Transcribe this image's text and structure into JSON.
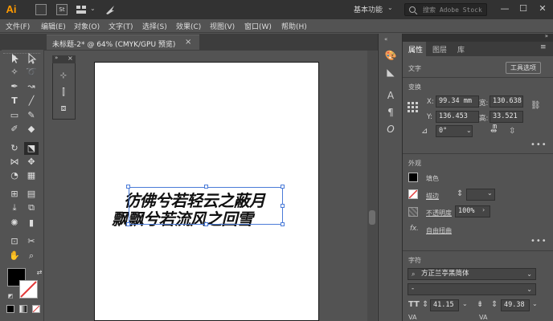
{
  "app": {
    "logo": "Ai",
    "workspace": "基本功能",
    "search_placeholder": "搜索 Adobe Stock",
    "window_controls": [
      "—",
      "☐",
      "✕"
    ]
  },
  "menubar": {
    "items": [
      "文件(F)",
      "编辑(E)",
      "对象(O)",
      "文字(T)",
      "选择(S)",
      "效果(C)",
      "视图(V)",
      "窗口(W)",
      "帮助(H)"
    ]
  },
  "document_tab": {
    "title": "未标题-2* @ 64% (CMYK/GPU 预览)",
    "close": "×"
  },
  "artboard": {
    "line1": "彷佛兮若轻云之蔽月",
    "line2": "飘飘兮若流风之回雪"
  },
  "properties": {
    "tabs": [
      "属性",
      "图层",
      "库"
    ],
    "text_section": "文字",
    "tool_options_button": "工具选项",
    "transform": {
      "title": "变换",
      "x_label": "X:",
      "x_value": "99.34 mm",
      "y_label": "Y:",
      "y_value": "136.453",
      "w_label": "宽:",
      "w_value": "130.638",
      "h_label": "高:",
      "h_value": "33.521 m",
      "angle_value": "0°"
    },
    "appearance": {
      "title": "外观",
      "fill_label": "填色",
      "stroke_label": "描边",
      "opacity_label": "不透明度",
      "opacity_value": "100%",
      "fx_label": "自由扭曲",
      "fx_icon": "fx."
    },
    "character": {
      "title": "字符",
      "font_family": "方正兰亭黑简体",
      "font_style": "-",
      "font_size": "41.15",
      "leading": "49.38"
    }
  },
  "colors": {
    "titlebar": "#323232",
    "panel": "#535353",
    "ai_orange": "#ff9a00",
    "selection": "#4a7bd8"
  }
}
